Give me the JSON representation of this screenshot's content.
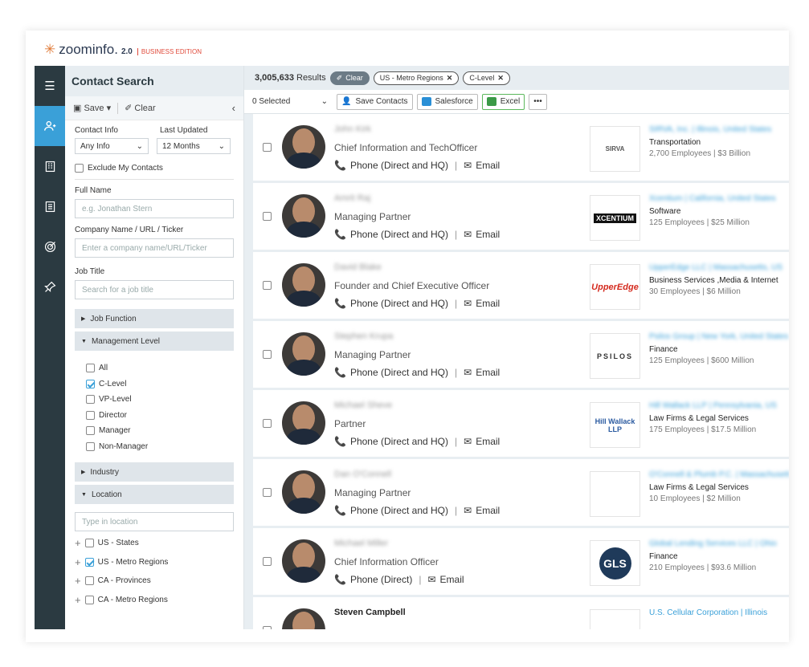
{
  "brand": {
    "name": "zoominfo.",
    "version": "2.0",
    "edition": "BUSINESS EDITION"
  },
  "sidebar": {
    "title": "Contact Search",
    "save": "Save",
    "clear": "Clear",
    "contact_info_label": "Contact Info",
    "last_updated_label": "Last Updated",
    "contact_info_value": "Any Info",
    "last_updated_value": "12 Months",
    "exclude": "Exclude My Contacts",
    "full_name_label": "Full Name",
    "full_name_ph": "e.g. Jonathan Stern",
    "company_label": "Company Name / URL / Ticker",
    "company_ph": "Enter a company name/URL/Ticker",
    "job_title_label": "Job Title",
    "job_title_ph": "Search for a job title",
    "job_function": "Job Function",
    "management_level": "Management Level",
    "levels": [
      {
        "label": "All",
        "checked": false
      },
      {
        "label": "C-Level",
        "checked": true
      },
      {
        "label": "VP-Level",
        "checked": false
      },
      {
        "label": "Director",
        "checked": false
      },
      {
        "label": "Manager",
        "checked": false
      },
      {
        "label": "Non-Manager",
        "checked": false
      }
    ],
    "industry": "Industry",
    "location": "Location",
    "location_ph": "Type in location",
    "locations": [
      {
        "label": "US - States",
        "checked": false
      },
      {
        "label": "US - Metro Regions",
        "checked": true
      },
      {
        "label": "CA - Provinces",
        "checked": false
      },
      {
        "label": "CA - Metro Regions",
        "checked": false
      }
    ]
  },
  "results": {
    "count": "3,005,633",
    "count_suffix": "Results",
    "clear": "Clear",
    "filters": [
      "US - Metro Regions",
      "C-Level"
    ],
    "selected": "0 Selected",
    "save_contacts": "Save Contacts",
    "salesforce": "Salesforce",
    "excel": "Excel",
    "more": "•••"
  },
  "colors": {
    "rail": "#2b3a41",
    "accent": "#3aa0d8",
    "brand_orange": "#e07b39"
  },
  "contacts": [
    {
      "name": "John Kirk",
      "title": "Chief Information and TechOfficer",
      "phone": "Phone (Direct and HQ)",
      "email": "Email",
      "logo": "SIRVA",
      "company": "SIRVA, Inc. | Illinois, United States",
      "industry": "Transportation",
      "employees": "2,700 Employees |  $3 Billion"
    },
    {
      "name": "Amrit Raj",
      "title": "Managing Partner",
      "phone": "Phone (Direct and HQ)",
      "email": "Email",
      "logo": "XCENTIUM",
      "company": "Xcentium | California, United States",
      "industry": "Software",
      "employees": "125 Employees |  $25 Million"
    },
    {
      "name": "David Blake",
      "title": "Founder and Chief Executive Officer",
      "phone": "Phone (Direct and HQ)",
      "email": "Email",
      "logo": "UpperEdge",
      "company": "UpperEdge LLC | Massachusetts, US",
      "industry": "Business Services ,Media & Internet",
      "employees": "30 Employees |  $6 Million"
    },
    {
      "name": "Stephen Krupa",
      "title": "Managing Partner",
      "phone": "Phone (Direct and HQ)",
      "email": "Email",
      "logo": "PSILOS",
      "company": "Psilos Group | New York, United States",
      "industry": "Finance",
      "employees": "125 Employees |  $600 Million"
    },
    {
      "name": "Michael Sheve",
      "title": "Partner",
      "phone": "Phone (Direct and HQ)",
      "email": "Email",
      "logo": "Hill Wallack LLP",
      "company": "Hill Wallack LLP | Pennsylvania, US",
      "industry": "Law Firms & Legal Services",
      "employees": "175 Employees |  $17.5 Million"
    },
    {
      "name": "Dan O'Connell",
      "title": "Managing Partner",
      "phone": "Phone (Direct and HQ)",
      "email": "Email",
      "logo": "",
      "company": "O'Connell & Plumb P.C. | Massachusetts",
      "industry": "Law Firms & Legal Services",
      "employees": "10 Employees |  $2 Million"
    },
    {
      "name": "Michael Miller",
      "title": "Chief Information Officer",
      "phone": "Phone (Direct)",
      "email": "Email",
      "logo": "GLS",
      "company": "Global Lending Services LLC | Ohio",
      "industry": "Finance",
      "employees": "210 Employees |  $93.6 Million"
    },
    {
      "name": "Steven Campbell",
      "title": "",
      "phone": "",
      "email": "",
      "logo": "",
      "company": "U.S. Cellular Corporation | Illinois",
      "industry": "",
      "employees": ""
    }
  ]
}
